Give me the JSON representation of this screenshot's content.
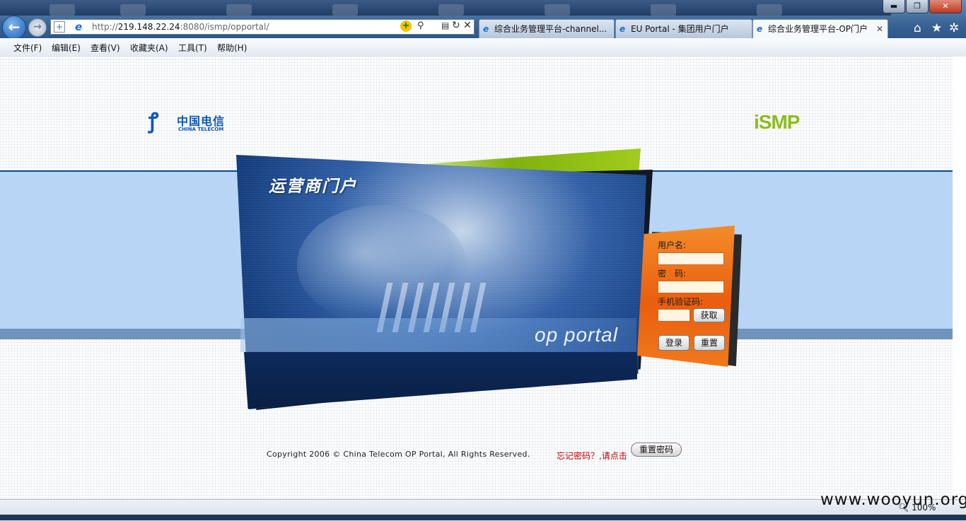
{
  "browser": {
    "address_scheme": "http://",
    "address_host": "219.148.22.24",
    "address_path": ":8080/ismp/opportal/",
    "tabs": [
      {
        "label": "综合业务管理平台-channel...",
        "active": false
      },
      {
        "label": "EU Portal - 集团用户门户",
        "active": false
      },
      {
        "label": "综合业务管理平台-OP门户",
        "active": true
      }
    ],
    "window_controls": {
      "minimize": "▬",
      "maximize": "❐",
      "close": "✕"
    },
    "zoom": "100%"
  },
  "menubar": {
    "items": [
      "文件(F)",
      "编辑(E)",
      "查看(V)",
      "收藏夹(A)",
      "工具(T)",
      "帮助(H)"
    ]
  },
  "header": {
    "brand_cn": "中国电信",
    "brand_en": "CHINA TELECOM",
    "product_logo": "iSMP"
  },
  "hero": {
    "title": "运营商门户",
    "subtitle": "op portal"
  },
  "login": {
    "username_label": "用户名:",
    "password_label": "密　码:",
    "sms_label": "手机验证码:",
    "get_code_button": "获取",
    "login_button": "登录",
    "reset_button": "重置",
    "username_value": "",
    "password_value": "",
    "sms_value": ""
  },
  "footer": {
    "copyright": "Copyright 2006 © China Telecom OP Portal, All Rights Reserved.",
    "forgot_text": "忘记密码？,请点击",
    "reset_password_button": "重置密码"
  },
  "watermark": "www.wooyun.org",
  "colors": {
    "brand_blue": "#1058b4",
    "ismp_green": "#8cbd1f",
    "login_orange": "#ea5d0e",
    "forgot_red": "#c00000"
  },
  "icons": [
    "back-arrow-icon",
    "forward-arrow-icon",
    "ie-icon",
    "refresh-icon",
    "stop-icon",
    "search-icon",
    "home-icon",
    "star-icon",
    "gear-icon"
  ]
}
